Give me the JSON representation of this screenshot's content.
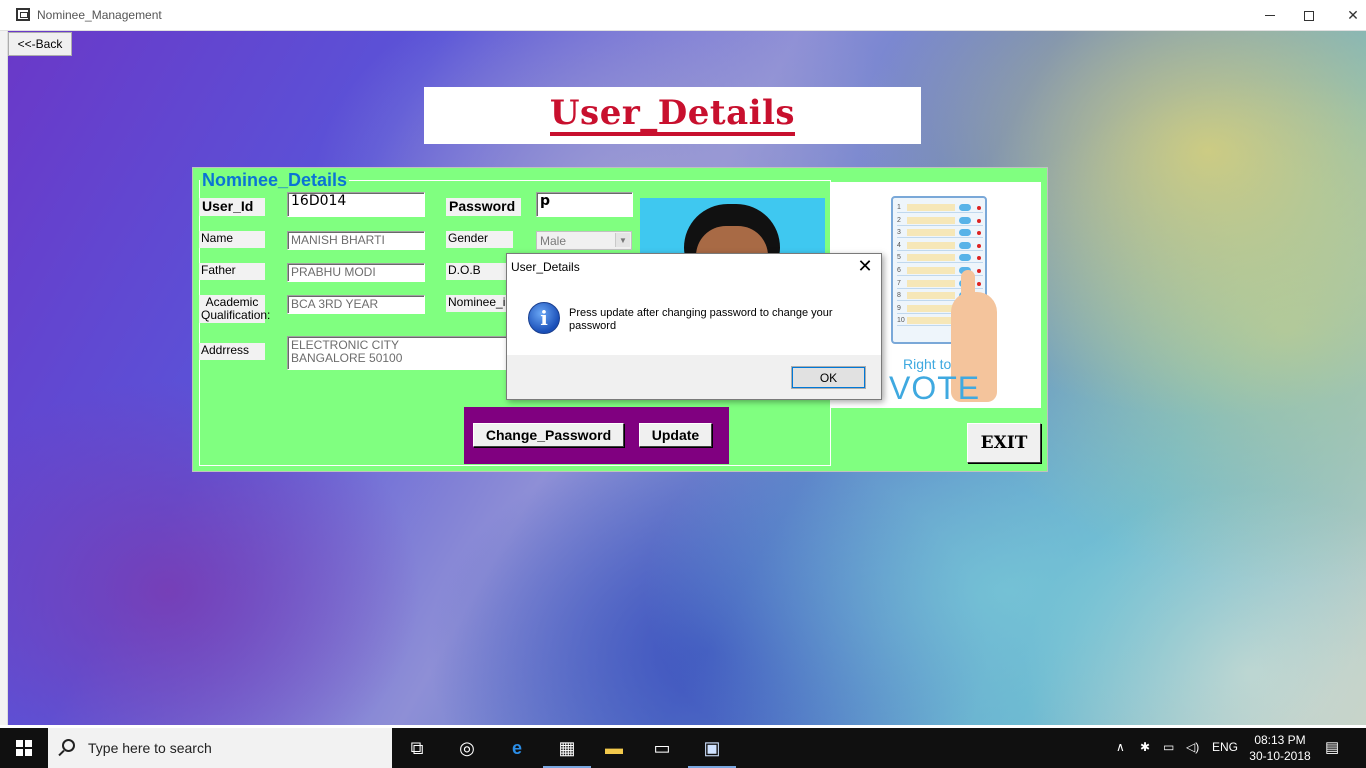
{
  "window": {
    "title": "Nominee_Management"
  },
  "back_button": {
    "label": "<<-Back"
  },
  "header": {
    "title": "User_Details"
  },
  "nominee": {
    "group_title": "Nominee_Details",
    "fields": {
      "user_id_label": "User_Id",
      "user_id_value": "16D014",
      "password_label": "Password",
      "password_value": "p",
      "name_label": "Name",
      "name_value": "MANISH BHARTI",
      "gender_label": "Gender",
      "gender_value": "Male",
      "father_label": "Father",
      "father_value": "PRABHU MODI",
      "dob_label": "D.O.B",
      "academic_label": "Academic\nQualification:",
      "academic_value": "BCA 3RD YEAR",
      "nominee_img_label": "Nominee_im",
      "address_label": "Addrress",
      "address_value": "ELECTRONIC CITY\nBANGALORE 50100"
    },
    "buttons": {
      "change_password": "Change_Password",
      "update": "Update",
      "exit": "EXIT"
    },
    "vote_image": {
      "caption_small": "Right to",
      "caption_big": "VOTE",
      "row_numbers": [
        "1",
        "2",
        "3",
        "4",
        "5",
        "6",
        "7",
        "8",
        "9",
        "10"
      ]
    }
  },
  "dialog": {
    "title": "User_Details",
    "message": "Press update after changing password to change your password",
    "ok_label": "OK",
    "icon": "info-icon"
  },
  "taskbar": {
    "search_placeholder": "Type here to search",
    "language": "ENG",
    "time": "08:13 PM",
    "date": "30-10-2018"
  }
}
